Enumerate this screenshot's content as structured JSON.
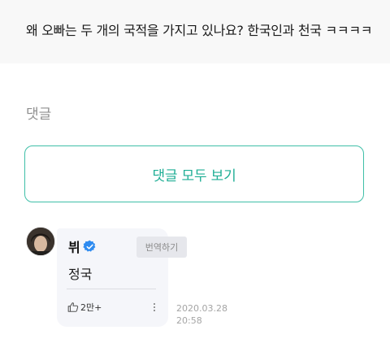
{
  "post": {
    "text": "왜 오빠는 두 개의 국적을 가지고 있나요? 한국인과 천국 ㅋㅋㅋㅋ"
  },
  "comments": {
    "heading": "댓글",
    "view_all_label": "댓글 모두 보기",
    "items": [
      {
        "author": "뷔",
        "verified": true,
        "translate_label": "번역하기",
        "text": "정국",
        "likes": "2만+",
        "date": "2020.03.28",
        "time": "20:58"
      }
    ]
  },
  "icons": {
    "verified": "verified-badge-icon",
    "like": "thumbs-up-icon",
    "more": "more-vertical-icon"
  },
  "colors": {
    "accent": "#1fae95",
    "border_accent": "#3fbfa8",
    "verified": "#2e8bf0",
    "muted": "#8f8f8f"
  }
}
